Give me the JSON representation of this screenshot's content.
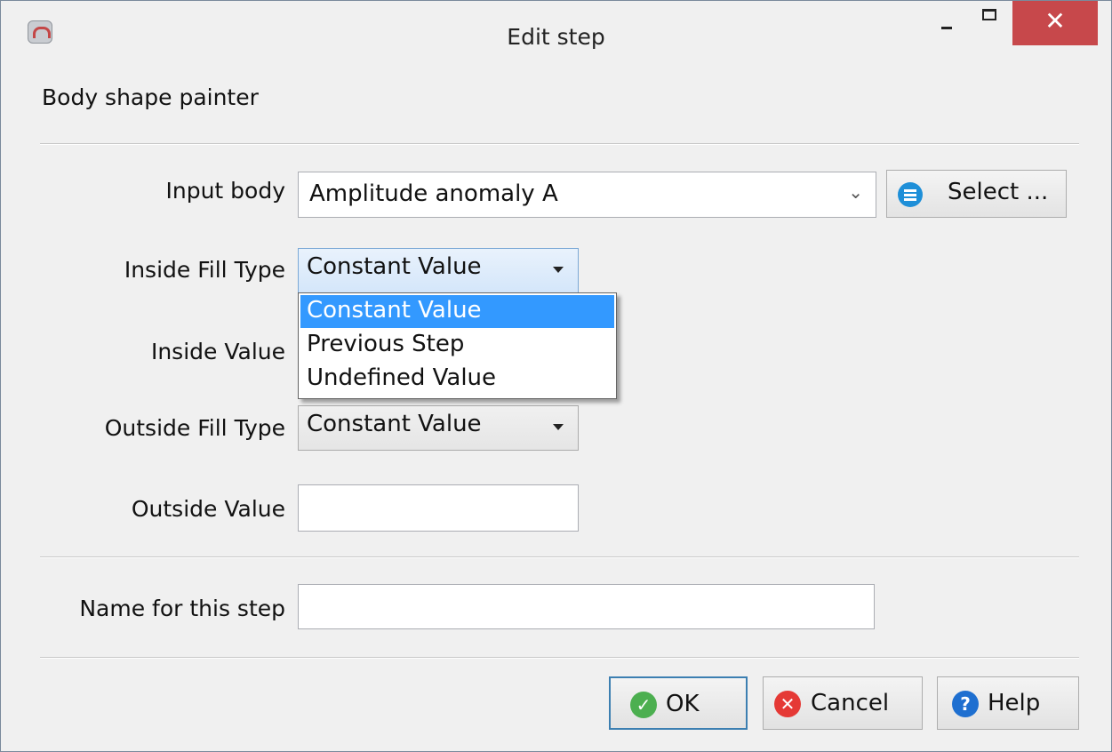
{
  "window": {
    "title": "Edit step",
    "close_glyph": "✕"
  },
  "section": {
    "title": "Body shape painter"
  },
  "form": {
    "input_body": {
      "label": "Input body",
      "value": "Amplitude anomaly A",
      "select_button": "Select ..."
    },
    "inside_fill_type": {
      "label": "Inside Fill Type",
      "value": "Constant Value",
      "options": [
        "Constant Value",
        "Previous Step",
        "Undefined Value"
      ],
      "highlighted_option": "Constant Value"
    },
    "inside_value": {
      "label": "Inside Value",
      "value": ""
    },
    "outside_fill_type": {
      "label": "Outside Fill Type",
      "value": "Constant Value"
    },
    "outside_value": {
      "label": "Outside Value",
      "value": ""
    },
    "step_name": {
      "label": "Name for this step",
      "value": ""
    }
  },
  "buttons": {
    "ok": "OK",
    "cancel": "Cancel",
    "help": "Help"
  },
  "icons": {
    "app": "app-icon",
    "select": "list-icon",
    "ok": "check-circle-icon",
    "cancel": "x-circle-icon",
    "help": "question-circle-icon",
    "minimize": "minimize-icon",
    "maximize": "maximize-icon",
    "close": "close-icon"
  },
  "colors": {
    "close_button": "#c7484b",
    "selection": "#3399ff",
    "ok_icon": "#4caf50",
    "cancel_icon": "#e53935",
    "help_icon": "#1e6fd0",
    "select_icon": "#1e8fd8"
  }
}
